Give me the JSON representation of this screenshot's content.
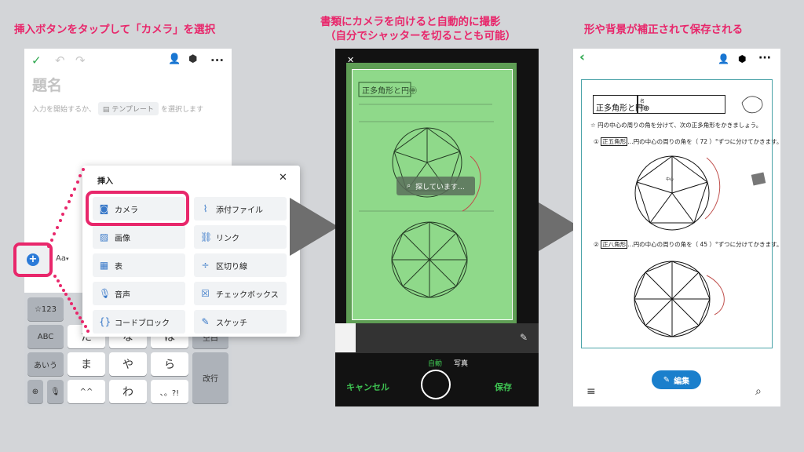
{
  "captions": {
    "step1": "挿入ボタンをタップして「カメラ」を選択",
    "step2_line1": "書類にカメラを向けると自動的に撮影",
    "step2_line2": "（自分でシャッターを切ることも可能）",
    "step3": "形や背景が補正されて保存される"
  },
  "colors": {
    "accent": "#e8276b",
    "blue": "#2b7bd8",
    "scan_green": "#8fd98a"
  },
  "editor": {
    "title_placeholder": "題名",
    "hint_before": "入力を開始するか、",
    "template_label": "テンプレート",
    "hint_after": "を選択します",
    "format_label": "Aa",
    "icons": [
      "check-icon",
      "undo-icon",
      "redo-icon",
      "add-person-icon",
      "share-note-icon",
      "more-icon"
    ]
  },
  "insert_menu": {
    "title": "挿入",
    "close": "✕",
    "items": [
      {
        "label": "カメラ",
        "icon": "camera-icon"
      },
      {
        "label": "添付ファイル",
        "icon": "paperclip-icon"
      },
      {
        "label": "画像",
        "icon": "image-icon"
      },
      {
        "label": "リンク",
        "icon": "link-icon"
      },
      {
        "label": "表",
        "icon": "table-icon"
      },
      {
        "label": "区切り線",
        "icon": "divider-icon"
      },
      {
        "label": "音声",
        "icon": "microphone-icon"
      },
      {
        "label": "チェックボックス",
        "icon": "checkbox-icon"
      },
      {
        "label": "コードブロック",
        "icon": "code-icon"
      },
      {
        "label": "スケッチ",
        "icon": "sketch-icon"
      }
    ]
  },
  "keyboard": {
    "numbers": "☆123",
    "abc": "ABC",
    "kana": "あいう",
    "keys_row1": [
      "た",
      "な",
      "は"
    ],
    "keys_row2": [
      "ま",
      "や",
      "ら"
    ],
    "keys_row3": [
      "^^",
      "わ",
      "､。?!"
    ],
    "space": "空白",
    "enter": "改行"
  },
  "camera": {
    "searching": "探しています…",
    "mode_auto": "自動",
    "mode_photo": "写真",
    "cancel": "キャンセル",
    "save": "保存"
  },
  "worksheet": {
    "title": "正多角形と円",
    "name_label": "名前",
    "intro": "☆ 円の中心の周りの角を分けて、次の正多角形をかきましょう。",
    "q1_number": "①",
    "q1_shape": "正五角形",
    "q1_text": "…円の中心の周りの角を（ 72 ）°ずつに分けてかきます。",
    "q2_number": "②",
    "q2_shape": "正八角形",
    "q2_text": "…円の中心の周りの角を（ 45 ）°ずつに分けてかきます。",
    "center_label": "中心"
  },
  "result": {
    "edit_label": "編集"
  }
}
